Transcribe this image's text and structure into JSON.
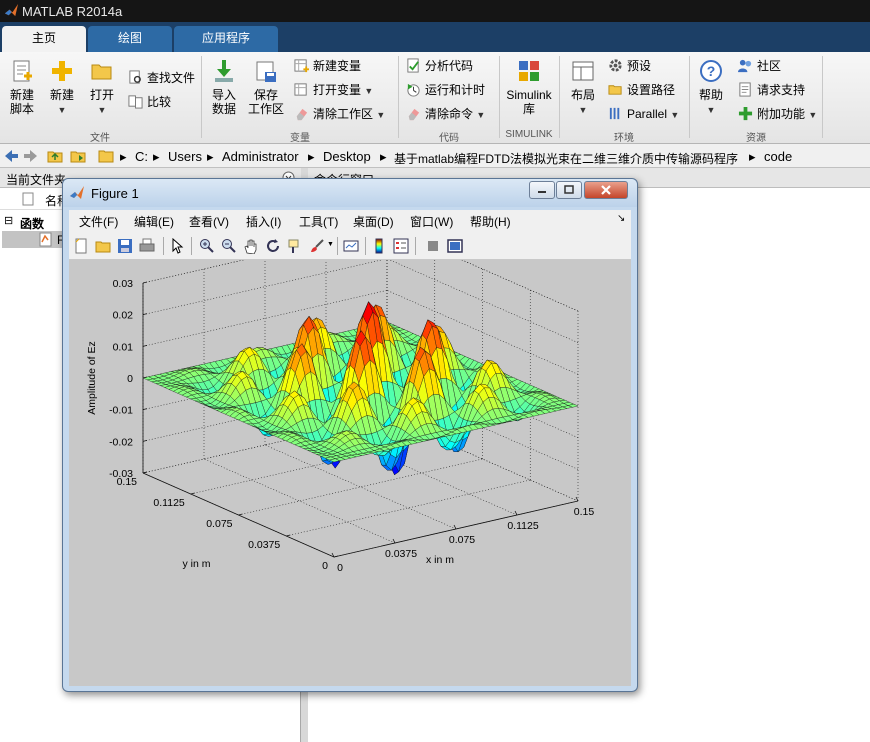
{
  "app": {
    "title": "MATLAB R2014a"
  },
  "tabs": [
    {
      "label": "主页"
    },
    {
      "label": "绘图"
    },
    {
      "label": "应用程序"
    }
  ],
  "ribbon": {
    "file": {
      "group": "文件",
      "new_script": [
        "新建",
        "脚本"
      ],
      "new": "新建",
      "open": "打开",
      "find_files": "查找文件",
      "compare": "比较"
    },
    "variable": {
      "group": "变量",
      "import": [
        "导入",
        "数据"
      ],
      "save_ws": [
        "保存",
        "工作区"
      ],
      "new_var": "新建变量",
      "open_var": "打开变量",
      "clear_ws": "清除工作区"
    },
    "code": {
      "group": "代码",
      "analyze": "分析代码",
      "run_time": "运行和计时",
      "clear_cmd": "清除命令"
    },
    "simulink": {
      "group": "SIMULINK",
      "label": [
        "Simulink",
        "库"
      ]
    },
    "env": {
      "group": "环境",
      "layout": "布局",
      "prefs": "预设",
      "set_path": "设置路径",
      "parallel": "Parallel"
    },
    "resources": {
      "group": "资源",
      "help": "帮助",
      "community": "社区",
      "support": "请求支持",
      "addons": "附加功能"
    }
  },
  "address": [
    "C:",
    "Users",
    "Administrator",
    "Desktop",
    "基于matlab编程FDTD法模拟光束在二维三维介质中传输源码程序",
    "code"
  ],
  "left_panel": {
    "title": "当前文件夹",
    "col_name": "名称",
    "section": "函数",
    "row_initial": "F"
  },
  "command_window": {
    "title": "命令行窗口"
  },
  "figure": {
    "title": "Figure 1",
    "menus": [
      "文件(F)",
      "编辑(E)",
      "查看(V)",
      "插入(I)",
      "工具(T)",
      "桌面(D)",
      "窗口(W)",
      "帮助(H)"
    ],
    "menu_arrow": "↘"
  },
  "chart_data": {
    "type": "surface",
    "title": "",
    "zlabel": "Amplitude of Ez",
    "xlabel": "x in m",
    "ylabel": "y in m",
    "z_ticks": [
      "0.03",
      "0.02",
      "0.01",
      "0",
      "-0.01",
      "-0.02",
      "-0.03"
    ],
    "x_ticks": [
      "0",
      "0.0375",
      "0.075",
      "0.1125",
      "0.15"
    ],
    "y_ticks": [
      "0",
      "0.0375",
      "0.075",
      "0.1125",
      "0.15"
    ],
    "xlim": [
      0,
      0.15
    ],
    "ylim": [
      0,
      0.15
    ],
    "zlim": [
      -0.03,
      0.03
    ],
    "colormap": "jet",
    "grid": true
  }
}
